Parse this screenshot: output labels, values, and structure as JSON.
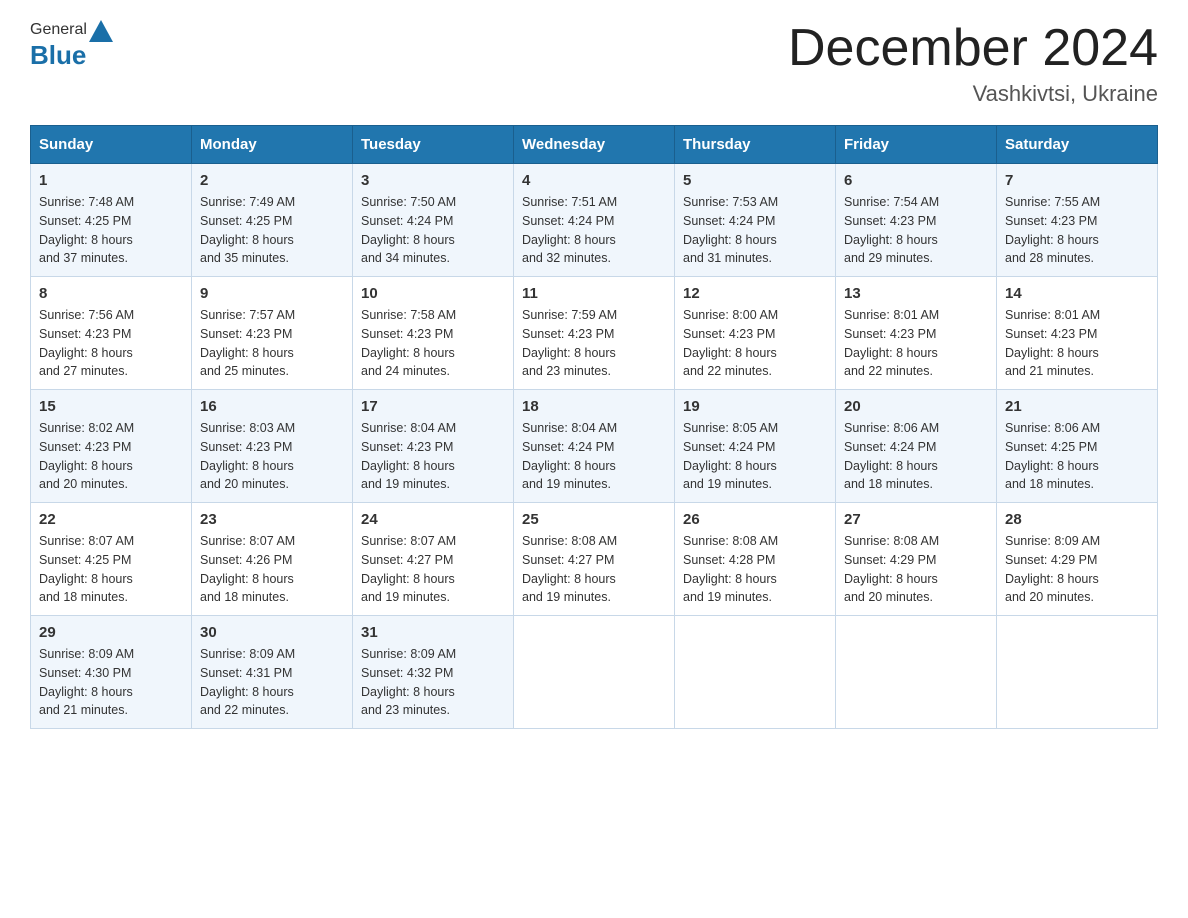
{
  "header": {
    "logo_general": "General",
    "logo_blue": "Blue",
    "month_title": "December 2024",
    "location": "Vashkivtsi, Ukraine"
  },
  "days_of_week": [
    "Sunday",
    "Monday",
    "Tuesday",
    "Wednesday",
    "Thursday",
    "Friday",
    "Saturday"
  ],
  "weeks": [
    [
      {
        "day": "1",
        "sunrise": "7:48 AM",
        "sunset": "4:25 PM",
        "daylight": "8 hours and 37 minutes."
      },
      {
        "day": "2",
        "sunrise": "7:49 AM",
        "sunset": "4:25 PM",
        "daylight": "8 hours and 35 minutes."
      },
      {
        "day": "3",
        "sunrise": "7:50 AM",
        "sunset": "4:24 PM",
        "daylight": "8 hours and 34 minutes."
      },
      {
        "day": "4",
        "sunrise": "7:51 AM",
        "sunset": "4:24 PM",
        "daylight": "8 hours and 32 minutes."
      },
      {
        "day": "5",
        "sunrise": "7:53 AM",
        "sunset": "4:24 PM",
        "daylight": "8 hours and 31 minutes."
      },
      {
        "day": "6",
        "sunrise": "7:54 AM",
        "sunset": "4:23 PM",
        "daylight": "8 hours and 29 minutes."
      },
      {
        "day": "7",
        "sunrise": "7:55 AM",
        "sunset": "4:23 PM",
        "daylight": "8 hours and 28 minutes."
      }
    ],
    [
      {
        "day": "8",
        "sunrise": "7:56 AM",
        "sunset": "4:23 PM",
        "daylight": "8 hours and 27 minutes."
      },
      {
        "day": "9",
        "sunrise": "7:57 AM",
        "sunset": "4:23 PM",
        "daylight": "8 hours and 25 minutes."
      },
      {
        "day": "10",
        "sunrise": "7:58 AM",
        "sunset": "4:23 PM",
        "daylight": "8 hours and 24 minutes."
      },
      {
        "day": "11",
        "sunrise": "7:59 AM",
        "sunset": "4:23 PM",
        "daylight": "8 hours and 23 minutes."
      },
      {
        "day": "12",
        "sunrise": "8:00 AM",
        "sunset": "4:23 PM",
        "daylight": "8 hours and 22 minutes."
      },
      {
        "day": "13",
        "sunrise": "8:01 AM",
        "sunset": "4:23 PM",
        "daylight": "8 hours and 22 minutes."
      },
      {
        "day": "14",
        "sunrise": "8:01 AM",
        "sunset": "4:23 PM",
        "daylight": "8 hours and 21 minutes."
      }
    ],
    [
      {
        "day": "15",
        "sunrise": "8:02 AM",
        "sunset": "4:23 PM",
        "daylight": "8 hours and 20 minutes."
      },
      {
        "day": "16",
        "sunrise": "8:03 AM",
        "sunset": "4:23 PM",
        "daylight": "8 hours and 20 minutes."
      },
      {
        "day": "17",
        "sunrise": "8:04 AM",
        "sunset": "4:23 PM",
        "daylight": "8 hours and 19 minutes."
      },
      {
        "day": "18",
        "sunrise": "8:04 AM",
        "sunset": "4:24 PM",
        "daylight": "8 hours and 19 minutes."
      },
      {
        "day": "19",
        "sunrise": "8:05 AM",
        "sunset": "4:24 PM",
        "daylight": "8 hours and 19 minutes."
      },
      {
        "day": "20",
        "sunrise": "8:06 AM",
        "sunset": "4:24 PM",
        "daylight": "8 hours and 18 minutes."
      },
      {
        "day": "21",
        "sunrise": "8:06 AM",
        "sunset": "4:25 PM",
        "daylight": "8 hours and 18 minutes."
      }
    ],
    [
      {
        "day": "22",
        "sunrise": "8:07 AM",
        "sunset": "4:25 PM",
        "daylight": "8 hours and 18 minutes."
      },
      {
        "day": "23",
        "sunrise": "8:07 AM",
        "sunset": "4:26 PM",
        "daylight": "8 hours and 18 minutes."
      },
      {
        "day": "24",
        "sunrise": "8:07 AM",
        "sunset": "4:27 PM",
        "daylight": "8 hours and 19 minutes."
      },
      {
        "day": "25",
        "sunrise": "8:08 AM",
        "sunset": "4:27 PM",
        "daylight": "8 hours and 19 minutes."
      },
      {
        "day": "26",
        "sunrise": "8:08 AM",
        "sunset": "4:28 PM",
        "daylight": "8 hours and 19 minutes."
      },
      {
        "day": "27",
        "sunrise": "8:08 AM",
        "sunset": "4:29 PM",
        "daylight": "8 hours and 20 minutes."
      },
      {
        "day": "28",
        "sunrise": "8:09 AM",
        "sunset": "4:29 PM",
        "daylight": "8 hours and 20 minutes."
      }
    ],
    [
      {
        "day": "29",
        "sunrise": "8:09 AM",
        "sunset": "4:30 PM",
        "daylight": "8 hours and 21 minutes."
      },
      {
        "day": "30",
        "sunrise": "8:09 AM",
        "sunset": "4:31 PM",
        "daylight": "8 hours and 22 minutes."
      },
      {
        "day": "31",
        "sunrise": "8:09 AM",
        "sunset": "4:32 PM",
        "daylight": "8 hours and 23 minutes."
      },
      null,
      null,
      null,
      null
    ]
  ],
  "labels": {
    "sunrise": "Sunrise:",
    "sunset": "Sunset:",
    "daylight": "Daylight:"
  }
}
